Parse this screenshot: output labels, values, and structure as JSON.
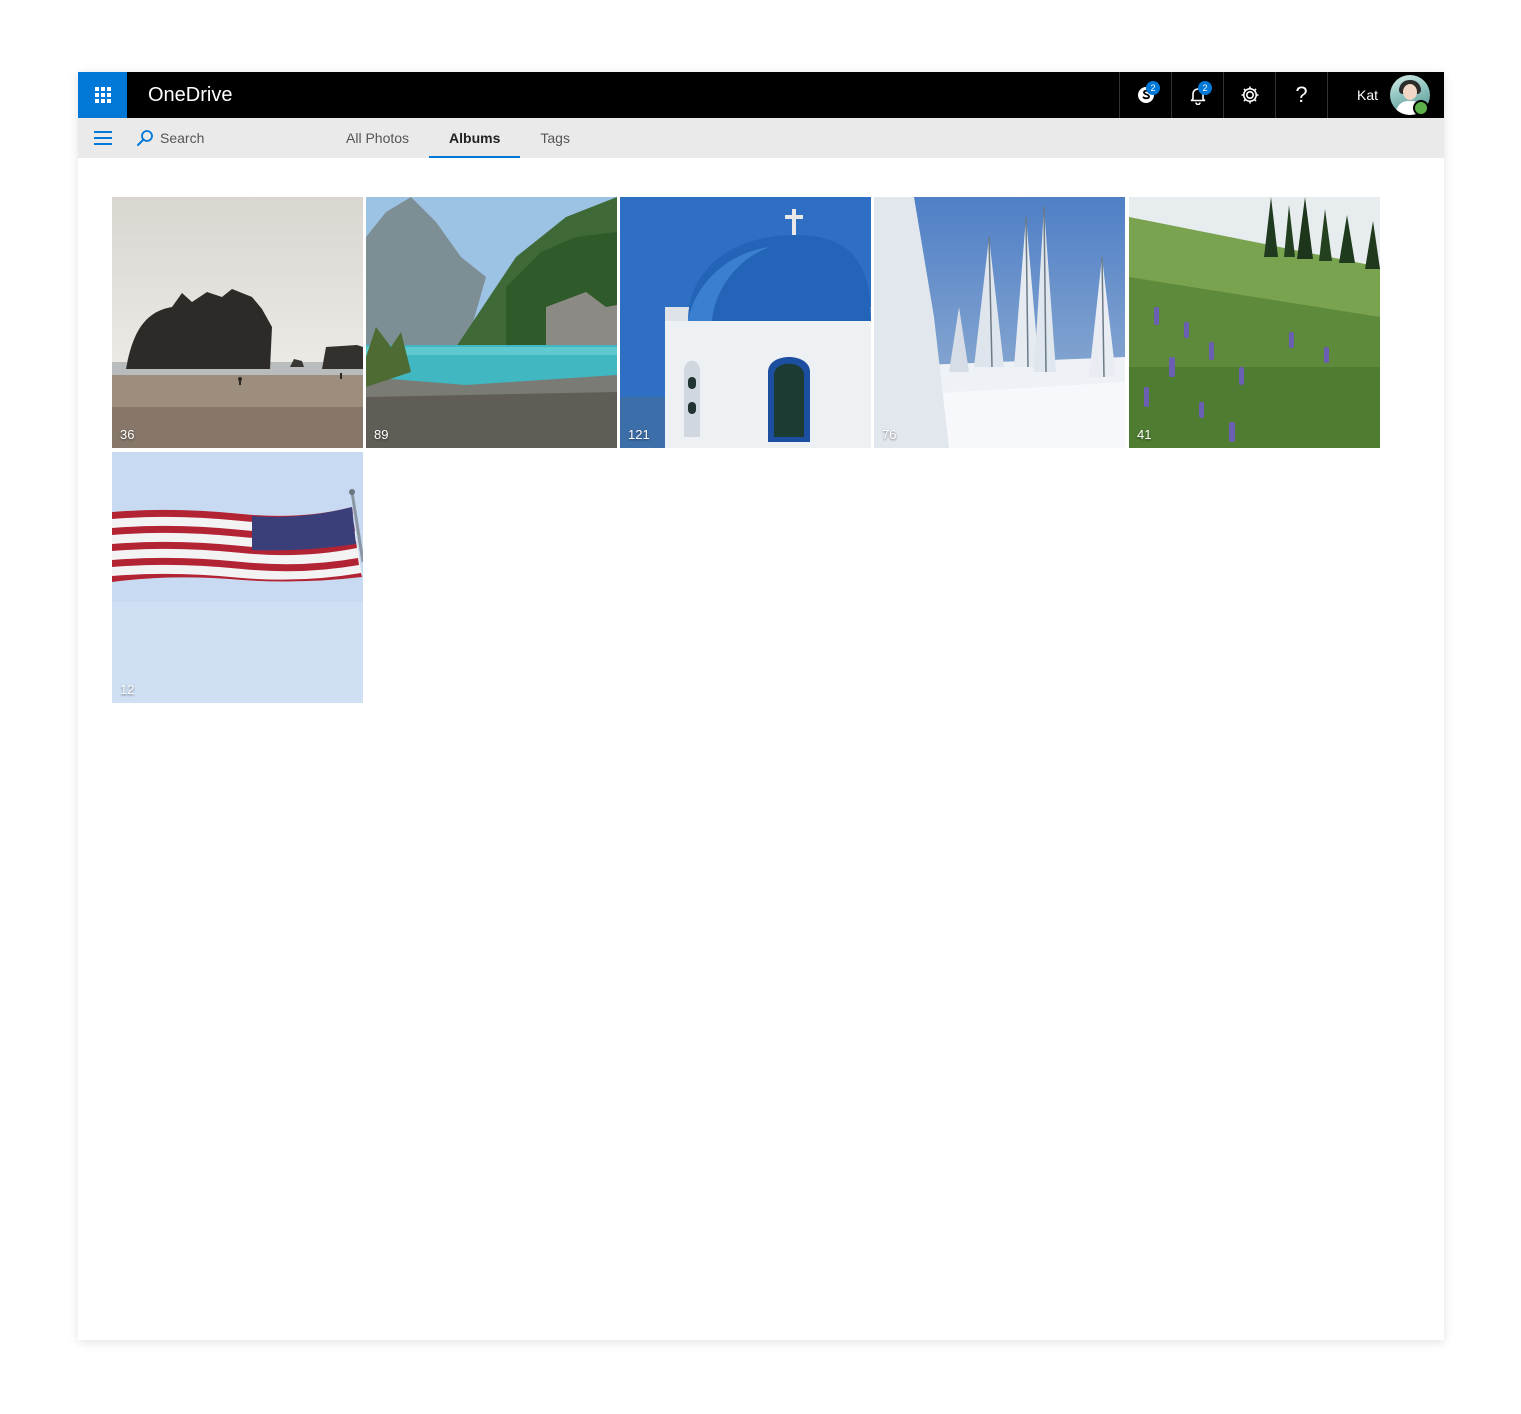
{
  "header": {
    "app_title": "OneDrive",
    "skype_badge": "2",
    "notifications_badge": "2",
    "help_label": "?",
    "user_name": "Kat"
  },
  "nav": {
    "search_placeholder": "Search",
    "tabs": [
      {
        "label": "All Photos",
        "active": false
      },
      {
        "label": "Albums",
        "active": true
      },
      {
        "label": "Tags",
        "active": false
      }
    ]
  },
  "albums": [
    {
      "count": "36",
      "scene": "beach-sea-stack"
    },
    {
      "count": "89",
      "scene": "mountain-lake"
    },
    {
      "count": "121",
      "scene": "blue-dome-chapel"
    },
    {
      "count": "76",
      "scene": "snowy-trees"
    },
    {
      "count": "41",
      "scene": "wildflower-meadow"
    },
    {
      "count": "12",
      "scene": "american-flag"
    }
  ],
  "colors": {
    "accent": "#0078d7",
    "topbar": "#000000",
    "subbar": "#eaeaea",
    "presence": "#5db14a"
  }
}
